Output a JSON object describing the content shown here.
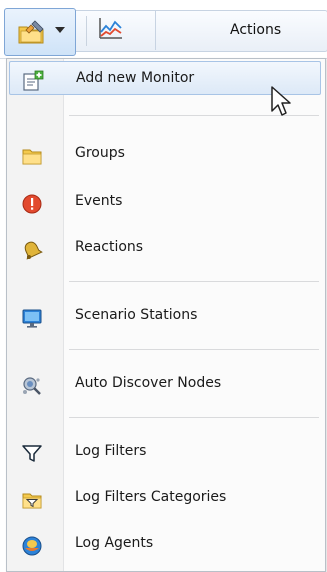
{
  "toolbar": {
    "add_dropdown_icon": "folder-edit-icon",
    "chart_icon": "line-chart-icon",
    "actions_label": "Actions"
  },
  "menu": {
    "items": [
      {
        "label": "Add new Monitor",
        "icon": "add-monitor-icon"
      },
      {
        "label": "Groups",
        "icon": "folder-icon"
      },
      {
        "label": "Events",
        "icon": "alert-icon"
      },
      {
        "label": "Reactions",
        "icon": "bell-icon"
      },
      {
        "label": "Scenario Stations",
        "icon": "monitor-icon"
      },
      {
        "label": "Auto Discover Nodes",
        "icon": "discover-icon"
      },
      {
        "label": "Log Filters",
        "icon": "filter-icon"
      },
      {
        "label": "Log Filters Categories",
        "icon": "filter-folder-icon"
      },
      {
        "label": "Log Agents",
        "icon": "agent-icon"
      }
    ]
  },
  "colors": {
    "hover_border": "#a8c4e6",
    "accent_blue": "#2c82d8",
    "alert_red": "#e24a2f",
    "folder_yellow": "#f2c94c"
  }
}
